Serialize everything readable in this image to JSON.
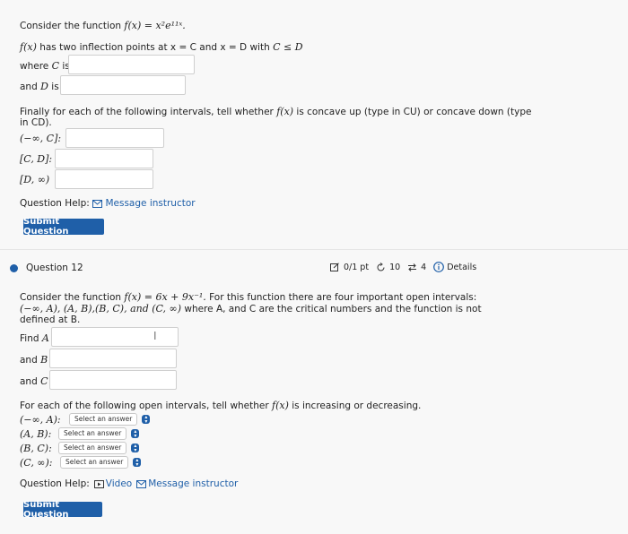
{
  "q11": {
    "intro": "Consider the function",
    "func": "f(x) = x²e¹¹ˣ.",
    "inflection_text": "has two inflection points at x = C and x = D with",
    "fx": "f(x)",
    "cond": "C ≤ D",
    "where_label": "where",
    "c_var": "C",
    "is": "is",
    "and_label": "and",
    "d_var": "D",
    "finally_line1": "Finally for each of the following intervals, tell whether",
    "finally_fx": "f(x)",
    "finally_line1b": "is concave up (type in CU) or concave down (type",
    "finally_line2": "in CD).",
    "intervals": [
      "(−∞, C]:",
      "[C, D]:",
      "[D, ∞)"
    ],
    "help_label": "Question Help:",
    "message_label": "Message instructor",
    "submit_label": "Submit Question"
  },
  "q12": {
    "title": "Question 12",
    "points": "0/1 pt",
    "retries": "10",
    "attempts": "4",
    "details": "Details",
    "intro": "Consider the function",
    "func": "f(x) = 6x + 9x⁻¹.",
    "intro_rest": "For this function there are four important open intervals:",
    "intervals_line": "(−∞, A), (A, B),(B, C), and (C, ∞)",
    "intervals_rest": "where A, and C are the critical numbers and the function is not",
    "defined_line": "defined at B.",
    "find_label": "Find",
    "a_var": "A",
    "and_label": "and",
    "b_var": "B",
    "c_var": "C",
    "inc_dec_text": "For each of the following open intervals, tell whether",
    "inc_dec_fx": "f(x)",
    "inc_dec_rest": "is increasing or decreasing.",
    "select_intervals": [
      "(−∞, A):",
      "(A, B):",
      "(B, C):",
      "(C, ∞):"
    ],
    "select_placeholder": "Select an answer",
    "help_label": "Question Help:",
    "video_label": "Video",
    "message_label": "Message instructor",
    "submit_label": "Submit Question"
  },
  "colors": {
    "accent": "#1f5fa8",
    "bullet": "#1f5fa8"
  }
}
